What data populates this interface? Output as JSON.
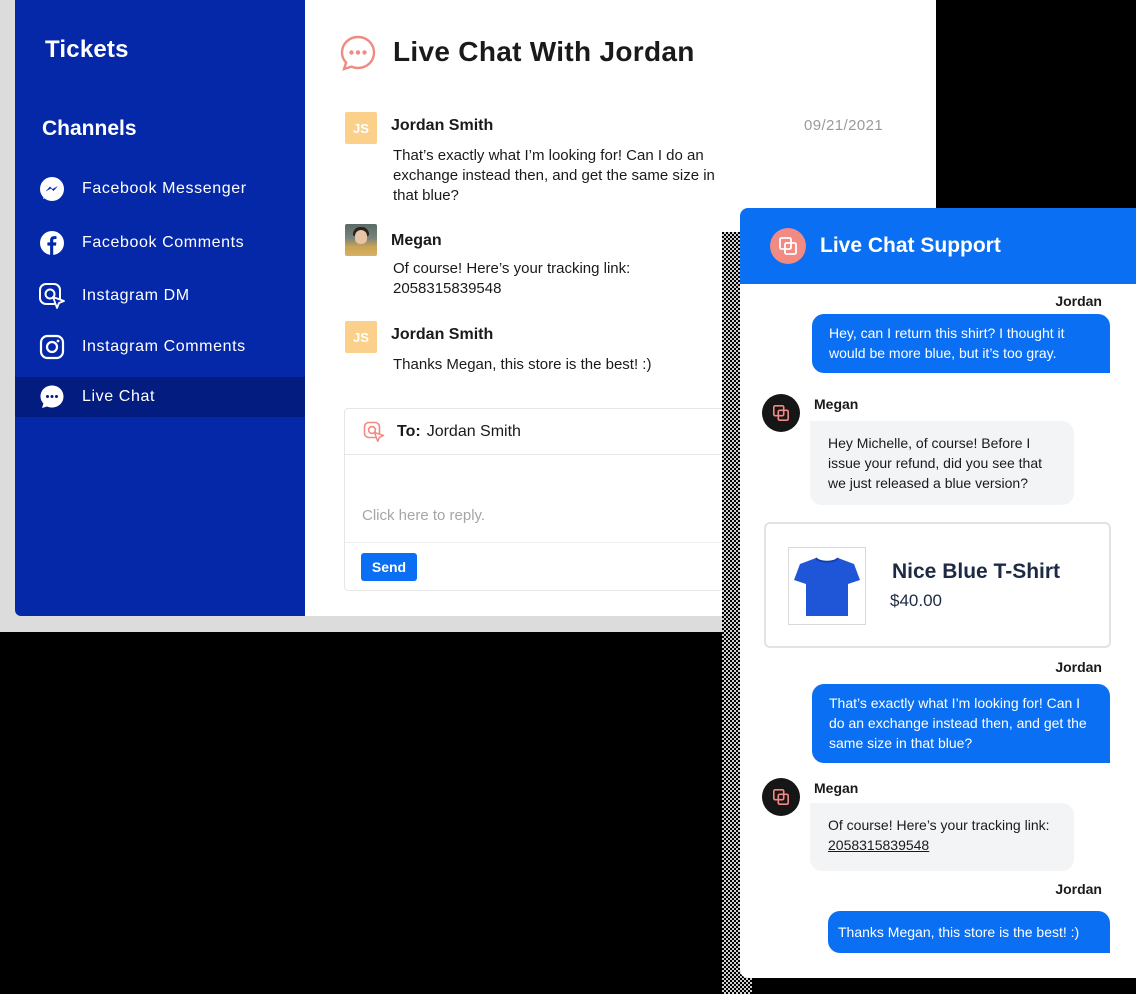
{
  "sidebar": {
    "title": "Tickets",
    "channels_heading": "Channels",
    "channels": [
      {
        "label": "Facebook Messenger",
        "icon": "messenger-icon"
      },
      {
        "label": "Facebook Comments",
        "icon": "facebook-icon"
      },
      {
        "label": "Instagram DM",
        "icon": "instagram-dm-icon"
      },
      {
        "label": "Instagram Comments",
        "icon": "instagram-icon"
      },
      {
        "label": "Live Chat",
        "icon": "live-chat-icon",
        "active": true
      }
    ]
  },
  "chat": {
    "title": "Live Chat With Jordan",
    "date": "09/21/2021",
    "messages": [
      {
        "initials": "JS",
        "name": "Jordan Smith",
        "text": "That’s exactly what I’m looking for! Can I do an exchange instead then, and get the same size in that blue?"
      },
      {
        "name": "Megan",
        "text": "Of course! Here’s your tracking link: 2058315839548"
      },
      {
        "initials": "JS",
        "name": "Jordan Smith",
        "text": "Thanks Megan, this store is the best! :)"
      }
    ],
    "reply": {
      "to_label": "To:",
      "to_name": "Jordan Smith",
      "placeholder": "Click here to reply.",
      "send_label": "Send"
    }
  },
  "widget": {
    "title": "Live Chat Support",
    "messages": [
      {
        "from": "Jordan",
        "text": "Hey, can I return this shirt? I thought it would be more blue, but it’s too gray."
      },
      {
        "from": "Megan",
        "text": "Hey Michelle, of course! Before I issue your refund, did you see that we just released a blue version?"
      },
      {
        "from": "Jordan",
        "text": "That’s exactly what I’m looking for! Can I do an exchange instead then, and get the same size in that blue?"
      },
      {
        "from": "Megan",
        "text_prefix": "Of course! Here’s your tracking link:",
        "link": "2058315839548"
      },
      {
        "from": "Jordan",
        "text": "Thanks Megan, this store is the best! :)"
      }
    ],
    "product": {
      "name": "Nice Blue T-Shirt",
      "price": "$40.00",
      "image": "blue-tshirt"
    }
  },
  "colors": {
    "sidebar": "#0528a8",
    "sidebar_active": "#031c80",
    "accent_blue": "#0a6ff2",
    "coral": "#f08a82",
    "avatar_initials": "#fbd08a"
  }
}
